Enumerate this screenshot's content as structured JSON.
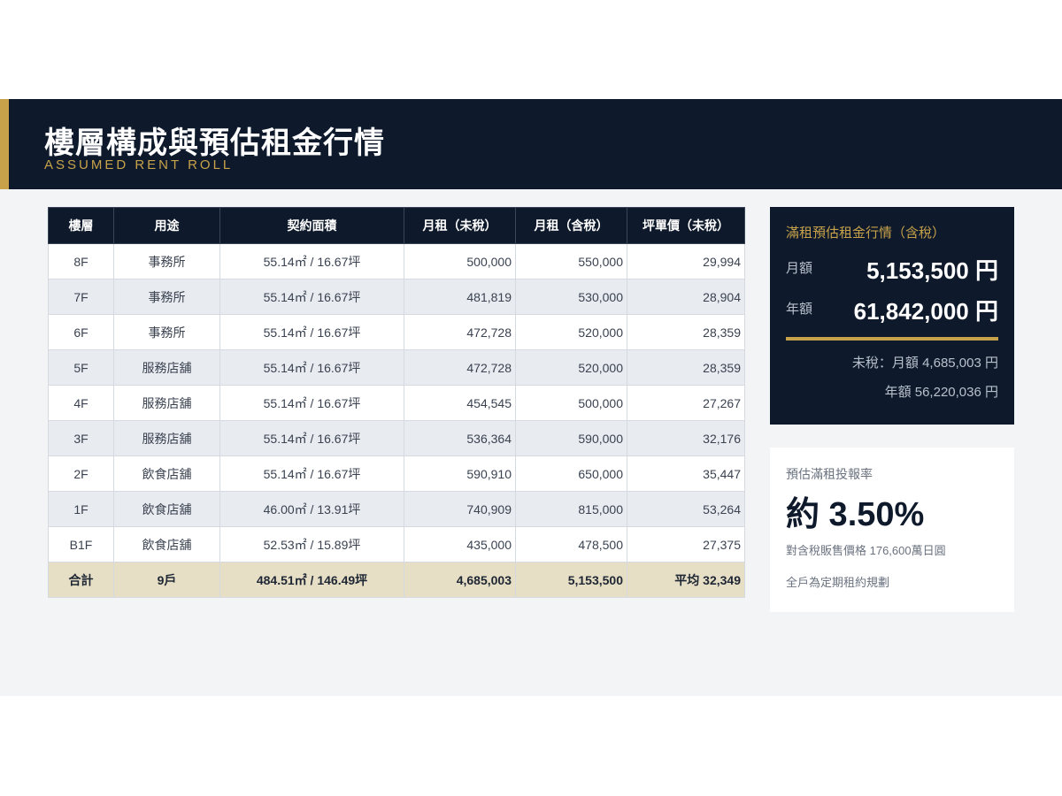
{
  "header": {
    "title": "樓層構成與預估租金行情",
    "subtitle": "ASSUMED RENT ROLL"
  },
  "table": {
    "columns": [
      "樓層",
      "用途",
      "契約面積",
      "月租（未稅）",
      "月租（含稅）",
      "坪單價（未稅）"
    ],
    "rows": [
      {
        "floor": "8F",
        "use": "事務所",
        "area": "55.14㎡ / 16.67坪",
        "rent_ex": "500,000",
        "rent_inc": "550,000",
        "tsubo": "29,994"
      },
      {
        "floor": "7F",
        "use": "事務所",
        "area": "55.14㎡ / 16.67坪",
        "rent_ex": "481,819",
        "rent_inc": "530,000",
        "tsubo": "28,904"
      },
      {
        "floor": "6F",
        "use": "事務所",
        "area": "55.14㎡ / 16.67坪",
        "rent_ex": "472,728",
        "rent_inc": "520,000",
        "tsubo": "28,359"
      },
      {
        "floor": "5F",
        "use": "服務店舖",
        "area": "55.14㎡ / 16.67坪",
        "rent_ex": "472,728",
        "rent_inc": "520,000",
        "tsubo": "28,359"
      },
      {
        "floor": "4F",
        "use": "服務店舖",
        "area": "55.14㎡ / 16.67坪",
        "rent_ex": "454,545",
        "rent_inc": "500,000",
        "tsubo": "27,267"
      },
      {
        "floor": "3F",
        "use": "服務店舖",
        "area": "55.14㎡ / 16.67坪",
        "rent_ex": "536,364",
        "rent_inc": "590,000",
        "tsubo": "32,176"
      },
      {
        "floor": "2F",
        "use": "飲食店舖",
        "area": "55.14㎡ / 16.67坪",
        "rent_ex": "590,910",
        "rent_inc": "650,000",
        "tsubo": "35,447"
      },
      {
        "floor": "1F",
        "use": "飲食店舖",
        "area": "46.00㎡ / 13.91坪",
        "rent_ex": "740,909",
        "rent_inc": "815,000",
        "tsubo": "53,264"
      },
      {
        "floor": "B1F",
        "use": "飲食店舖",
        "area": "52.53㎡ / 15.89坪",
        "rent_ex": "435,000",
        "rent_inc": "478,500",
        "tsubo": "27,375"
      }
    ],
    "total": {
      "floor": "合計",
      "use": "9戶",
      "area": "484.51㎡ / 146.49坪",
      "rent_ex": "4,685,003",
      "rent_inc": "5,153,500",
      "tsubo": "平均 32,349"
    }
  },
  "summary": {
    "heading": "滿租預估租金行情（含稅）",
    "monthly_label": "月額",
    "monthly_value": "5,153,500 円",
    "annual_label": "年額",
    "annual_value": "61,842,000 円",
    "note_monthly": "未稅：月額 4,685,003 円",
    "note_annual": "年額 56,220,036 円"
  },
  "yield": {
    "label": "預估滿租投報率",
    "value": "約 3.50%",
    "note1": "對含稅販售價格 176,600萬日圓",
    "note2": "全戶為定期租約規劃"
  },
  "colors": {
    "navy": "#0e1a2b",
    "gold": "#c8a24a",
    "zebra": "#e8ebf0",
    "total_row": "#e6dfc6"
  }
}
